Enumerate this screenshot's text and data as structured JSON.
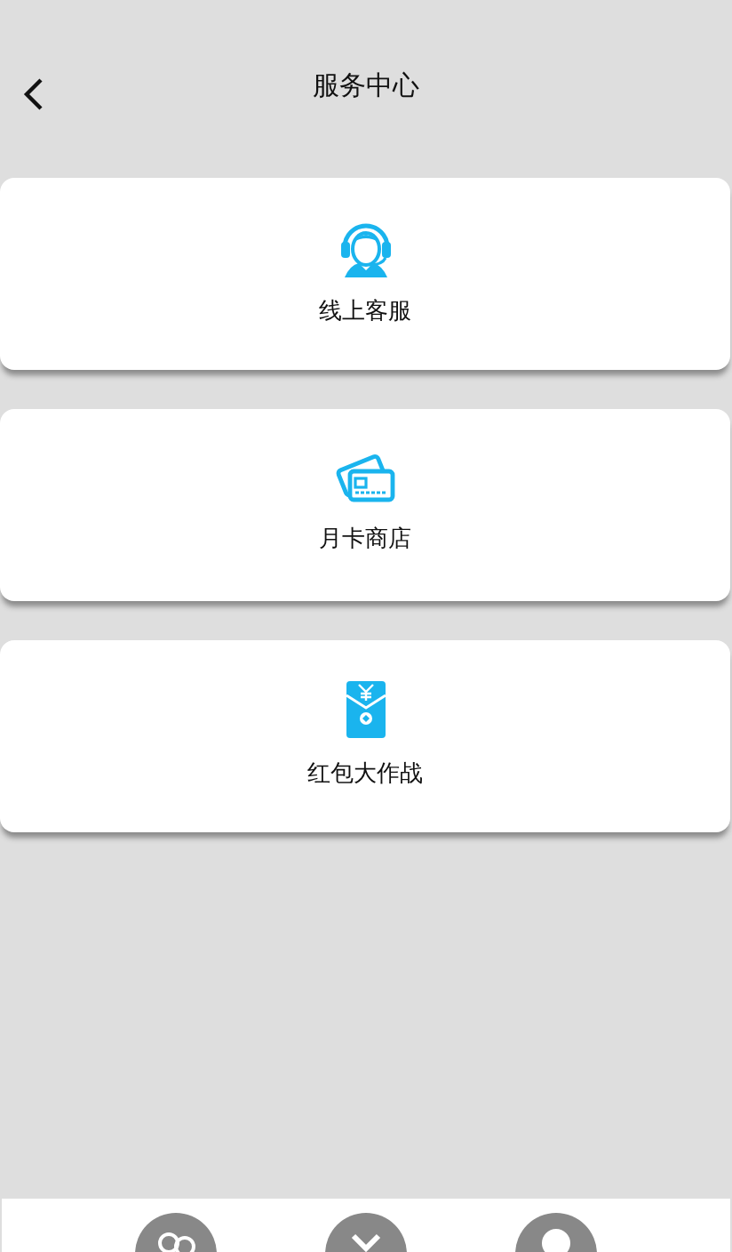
{
  "header": {
    "title": "服务中心"
  },
  "services": [
    {
      "kind": "support",
      "label": "线上客服"
    },
    {
      "kind": "card",
      "label": "月卡商店"
    },
    {
      "kind": "envelope",
      "label": "红包大作战"
    }
  ]
}
